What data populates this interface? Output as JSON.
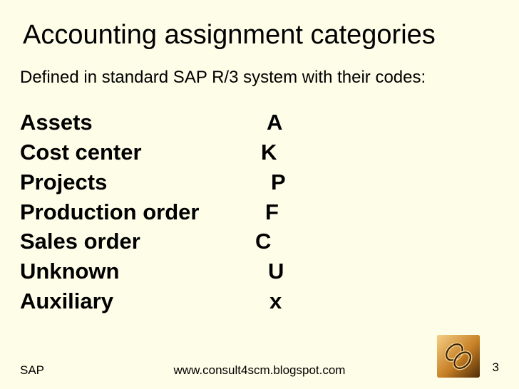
{
  "title": "Accounting assignment categories",
  "subtitle": "Defined in standard SAP R/3 system with their codes:",
  "rows": [
    {
      "label": "Assets",
      "code": "A"
    },
    {
      "label": "Cost center",
      "code": "K"
    },
    {
      "label": "Projects",
      "code": "P"
    },
    {
      "label": "Production order",
      "code": "F"
    },
    {
      "label": "Sales order",
      "code": "C"
    },
    {
      "label": "Unknown",
      "code": "U"
    },
    {
      "label": "Auxiliary",
      "code": "x"
    }
  ],
  "footer": {
    "left": "SAP",
    "center": "www.consult4scm.blogspot.com",
    "page": "3"
  },
  "icon_name": "chain-link-icon"
}
